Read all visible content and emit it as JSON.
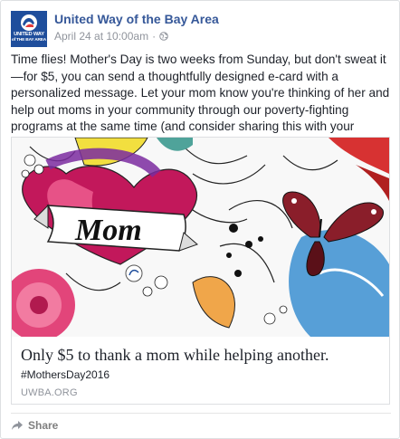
{
  "post": {
    "page_name": "United Way of the Bay Area",
    "timestamp": "April 24 at 10:00am",
    "separator": "·",
    "logo": {
      "line1": "UNITED WAY",
      "line2": "of THE BAY AREA"
    },
    "text": "Time flies! Mother's Day is two weeks from Sunday, but don't sweat it—for $5, you can send a thoughtfully designed e-card with a personalized message. Let your mom know you're thinking of her and help out moms in your community through our poverty-fighting programs at the same time (and consider sharing this with your friends!)"
  },
  "card": {
    "image_label": "Mom",
    "title": "Only $5 to thank a mom while helping another.",
    "hashtag": "#MothersDay2016",
    "domain": "UWBA.ORG"
  },
  "actions": {
    "share_label": "Share"
  },
  "colors": {
    "brand_blue": "#1f4e9c",
    "link_blue": "#365899",
    "meta_gray": "#90949c"
  },
  "icons": [
    "globe-icon",
    "share-arrow-icon",
    "united-way-logo"
  ]
}
